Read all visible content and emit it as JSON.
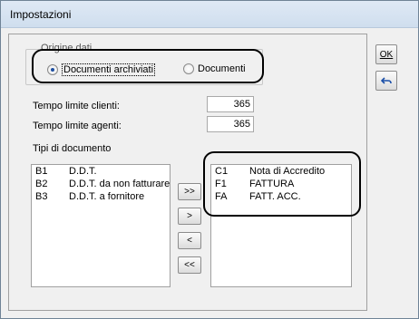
{
  "window": {
    "title": "Impostazioni"
  },
  "origine": {
    "legend": "Origine dati",
    "options": [
      {
        "label": "Documenti archiviati",
        "checked": true
      },
      {
        "label": "Documenti",
        "checked": false
      }
    ]
  },
  "limits": {
    "clienti": {
      "label": "Tempo limite clienti:",
      "value": "365"
    },
    "agenti": {
      "label": "Tempo limite agenti:",
      "value": "365"
    }
  },
  "tipi": {
    "label": "Tipi di documento",
    "available": [
      {
        "code": "B1",
        "desc": "D.D.T."
      },
      {
        "code": "B2",
        "desc": "D.D.T. da non fatturare"
      },
      {
        "code": "B3",
        "desc": "D.D.T. a fornitore"
      }
    ],
    "selected": [
      {
        "code": "C1",
        "desc": "Nota di Accredito"
      },
      {
        "code": "F1",
        "desc": "FATTURA"
      },
      {
        "code": "FA",
        "desc": "FATT. ACC."
      }
    ]
  },
  "transfer_buttons": {
    "add_all": ">>",
    "add": ">",
    "remove": "<",
    "remove_all": "<<"
  },
  "side_buttons": {
    "ok": "OK",
    "undo_icon": "undo-icon"
  },
  "colors": {
    "window_bg": "#f0f0f0",
    "radio_dot": "#1f4fa0"
  }
}
